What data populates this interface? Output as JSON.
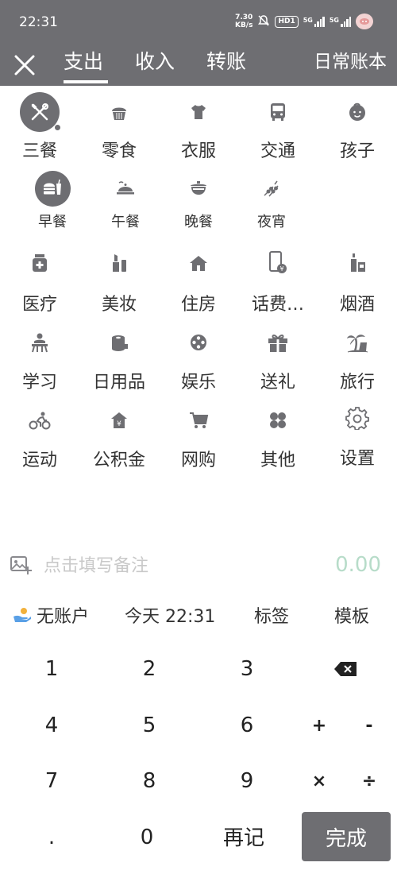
{
  "status": {
    "time": "22:31",
    "speed_value": "7.30",
    "speed_unit": "KB/s",
    "hd": "HD1",
    "sig1": "5G",
    "sig2": "5G"
  },
  "header": {
    "tabs": [
      "支出",
      "收入",
      "转账"
    ],
    "active_tab": "支出",
    "ledger": "日常账本"
  },
  "categories": [
    {
      "label": "三餐",
      "icon": "dining-icon",
      "selected": true
    },
    {
      "label": "零食",
      "icon": "cupcake-icon"
    },
    {
      "label": "衣服",
      "icon": "shirt-icon"
    },
    {
      "label": "交通",
      "icon": "bus-icon"
    },
    {
      "label": "孩子",
      "icon": "baby-icon"
    },
    {
      "label": "医疗",
      "icon": "medicine-icon"
    },
    {
      "label": "美妆",
      "icon": "cosmetics-icon"
    },
    {
      "label": "住房",
      "icon": "house-icon"
    },
    {
      "label": "话费…",
      "icon": "phone-bill-icon"
    },
    {
      "label": "烟酒",
      "icon": "tobacco-alcohol-icon"
    },
    {
      "label": "学习",
      "icon": "study-icon"
    },
    {
      "label": "日用品",
      "icon": "tissue-icon"
    },
    {
      "label": "娱乐",
      "icon": "film-reel-icon"
    },
    {
      "label": "送礼",
      "icon": "gift-icon"
    },
    {
      "label": "旅行",
      "icon": "palm-tree-icon"
    },
    {
      "label": "运动",
      "icon": "cycling-icon"
    },
    {
      "label": "公积金",
      "icon": "fund-house-icon"
    },
    {
      "label": "网购",
      "icon": "cart-icon"
    },
    {
      "label": "其他",
      "icon": "clover-icon"
    },
    {
      "label": "设置",
      "icon": "gear-icon"
    }
  ],
  "subcategories": [
    {
      "label": "早餐",
      "icon": "burger-drink-icon",
      "selected": true
    },
    {
      "label": "午餐",
      "icon": "cloche-icon"
    },
    {
      "label": "晚餐",
      "icon": "pot-icon"
    },
    {
      "label": "夜宵",
      "icon": "skewer-icon"
    }
  ],
  "note": {
    "placeholder": "点击填写备注",
    "value": ""
  },
  "amount": "0.00",
  "options": {
    "account": "无账户",
    "datetime": "今天 22:31",
    "tag": "标签",
    "template": "模板"
  },
  "keypad": {
    "keys": [
      "1",
      "2",
      "3",
      "4",
      "5",
      "6",
      "7",
      "8",
      "9",
      ".",
      "0"
    ],
    "plus": "+",
    "minus": "-",
    "times": "×",
    "divide": "÷",
    "again": "再记",
    "done": "完成"
  },
  "colors": {
    "header_bg": "#6e6e72",
    "icon": "#6e6e72",
    "amount": "#b7dcc9",
    "placeholder": "#c9c9c9"
  }
}
